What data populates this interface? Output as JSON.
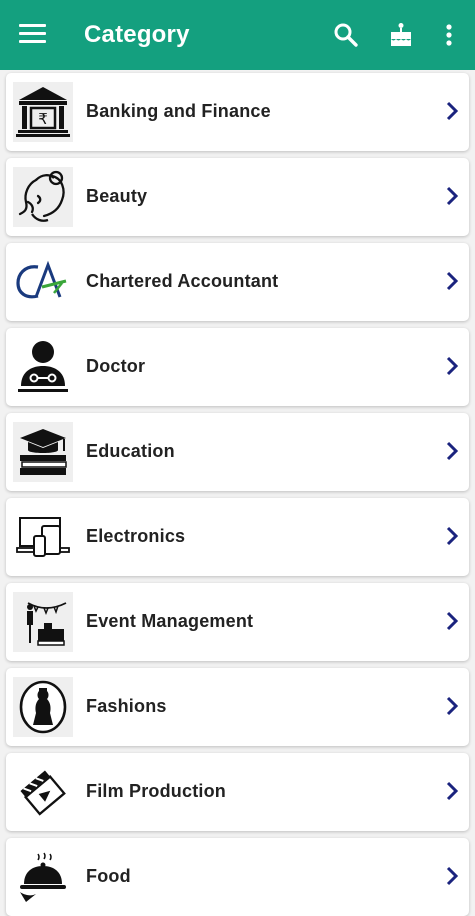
{
  "appbar": {
    "title": "Category",
    "background": "#14a07f",
    "icons": [
      "menu-icon",
      "search-icon",
      "cake-icon",
      "more-vert-icon"
    ]
  },
  "categories": [
    {
      "label": "Banking and Finance",
      "icon": "bank-icon"
    },
    {
      "label": "Beauty",
      "icon": "face-icon"
    },
    {
      "label": "Chartered Accountant",
      "icon": "ca-logo-icon"
    },
    {
      "label": "Doctor",
      "icon": "doctor-icon"
    },
    {
      "label": "Education",
      "icon": "graduation-cap-icon"
    },
    {
      "label": "Electronics",
      "icon": "devices-icon"
    },
    {
      "label": "Event Management",
      "icon": "event-icon"
    },
    {
      "label": "Fashions",
      "icon": "dress-icon"
    },
    {
      "label": "Film Production",
      "icon": "clapperboard-icon"
    },
    {
      "label": "Food",
      "icon": "food-cloche-icon"
    }
  ],
  "colors": {
    "accent": "#14a07f",
    "chevron": "#1a237e"
  }
}
